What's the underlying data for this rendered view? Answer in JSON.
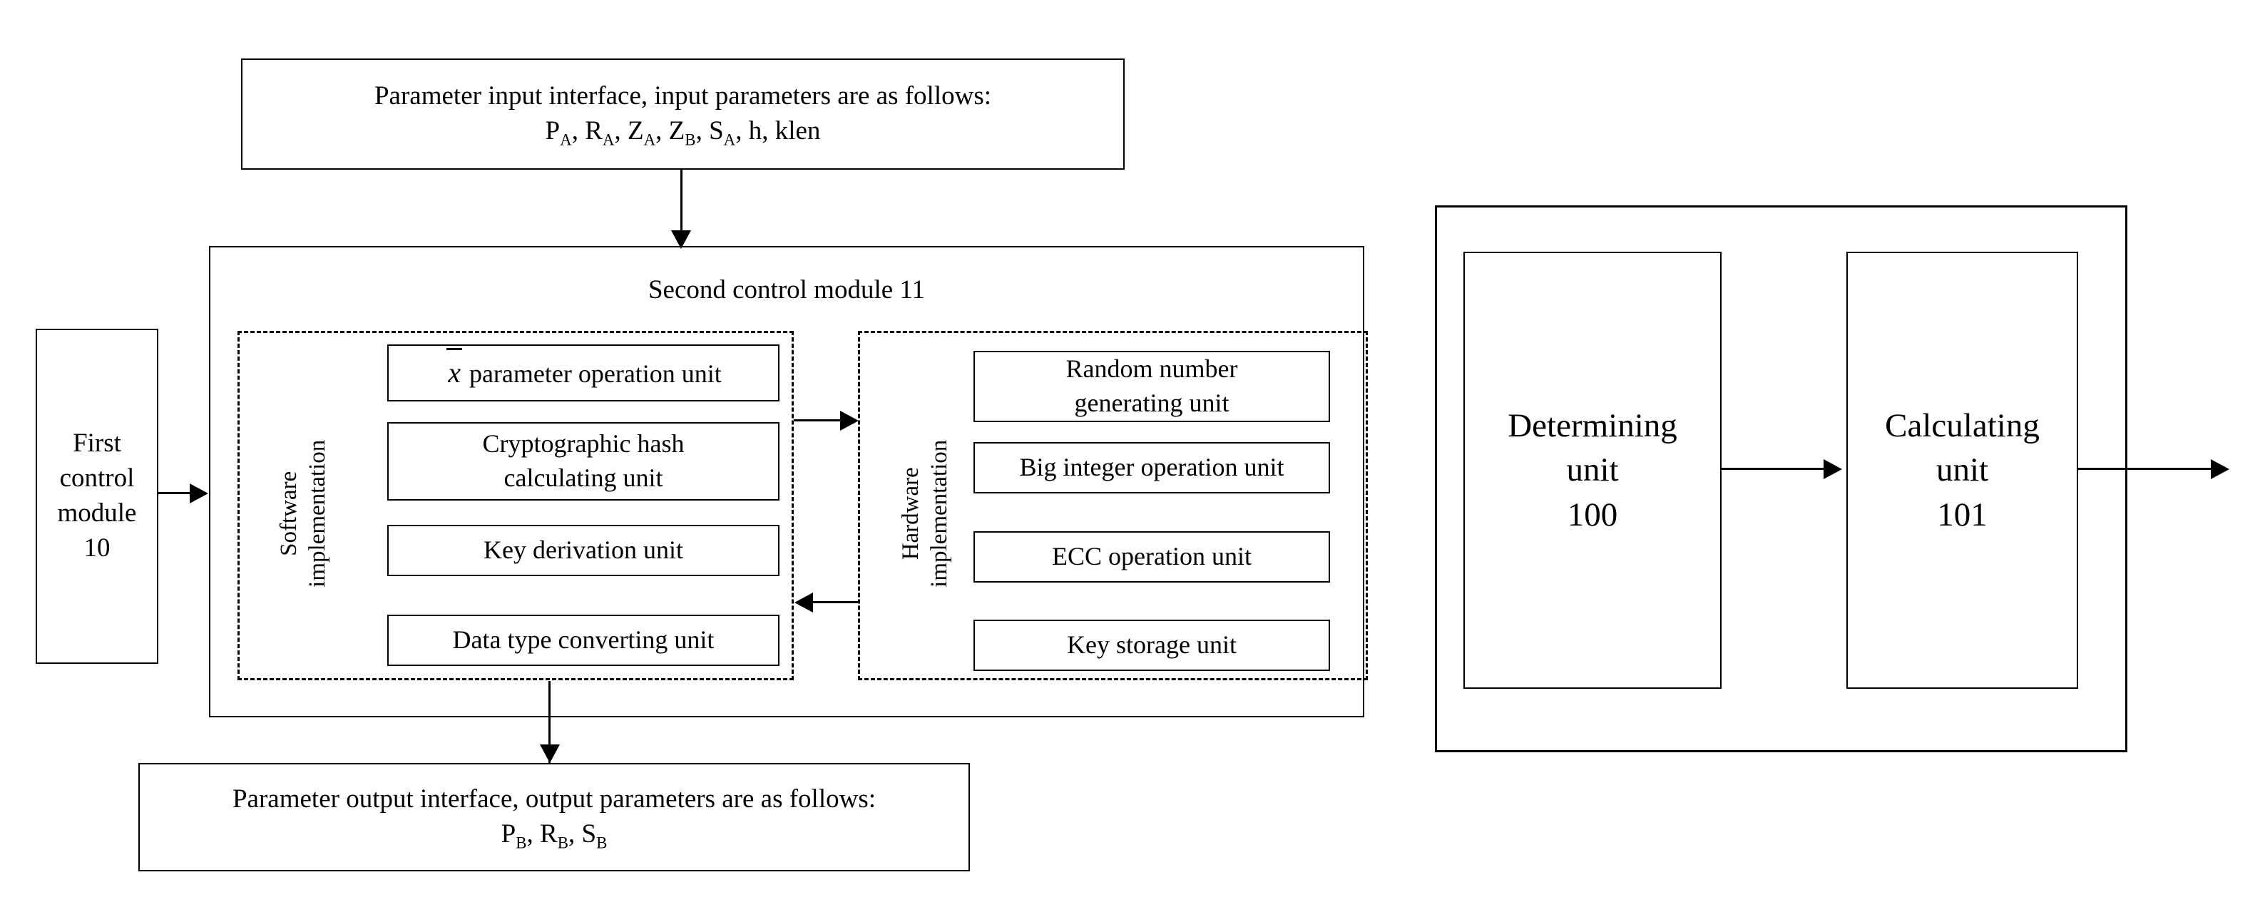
{
  "figure": {
    "kind": "patent-block-diagram",
    "ink_color": "#000000",
    "background_color": "#ffffff"
  },
  "left_diagram": {
    "input_interface": {
      "line1": "Parameter input interface, input parameters are as follows:",
      "params": [
        {
          "base": "P",
          "sub": "A"
        },
        {
          "base": "R",
          "sub": "A"
        },
        {
          "base": "Z",
          "sub": "A"
        },
        {
          "base": "Z",
          "sub": "B"
        },
        {
          "base": "S",
          "sub": "A"
        },
        {
          "base": "h",
          "sub": ""
        },
        {
          "base": "klen",
          "sub": ""
        }
      ]
    },
    "output_interface": {
      "line1": "Parameter output interface, output parameters are as follows:",
      "params": [
        {
          "base": "P",
          "sub": "B"
        },
        {
          "base": "R",
          "sub": "B"
        },
        {
          "base": "S",
          "sub": "B"
        }
      ]
    },
    "first_control_module": {
      "line1": "First",
      "line2": "control",
      "line3": "module",
      "line4": "10"
    },
    "second_control_module": {
      "title": "Second control module 11"
    },
    "software_group": {
      "label_line1": "Software",
      "label_line2": "implementation",
      "units": [
        {
          "prefix_symbol": "x-bar",
          "label": "parameter operation unit"
        },
        {
          "label_line1": "Cryptographic hash",
          "label_line2": "calculating unit"
        },
        {
          "label": "Key derivation unit"
        },
        {
          "label": "Data type converting unit"
        }
      ]
    },
    "hardware_group": {
      "label_line1": "Hardware",
      "label_line2": "implementation",
      "units": [
        {
          "label_line1": "Random number",
          "label_line2": "generating unit"
        },
        {
          "label": "Big integer operation unit"
        },
        {
          "label": "ECC operation unit"
        },
        {
          "label": "Key storage unit"
        }
      ]
    },
    "connectors": [
      {
        "name": "input-to-second-control",
        "direction": "down"
      },
      {
        "name": "first-control-to-second-control",
        "direction": "right"
      },
      {
        "name": "software-to-hardware",
        "direction": "right"
      },
      {
        "name": "hardware-to-software",
        "direction": "left"
      },
      {
        "name": "second-control-to-output",
        "direction": "down"
      }
    ]
  },
  "right_diagram": {
    "determining_unit": {
      "line1": "Determining",
      "line2": "unit",
      "line3": "100"
    },
    "calculating_unit": {
      "line1": "Calculating",
      "line2": "unit",
      "line3": "101"
    },
    "connectors": [
      {
        "name": "determining-to-calculating",
        "direction": "right"
      },
      {
        "name": "calculating-output",
        "direction": "right"
      }
    ]
  }
}
